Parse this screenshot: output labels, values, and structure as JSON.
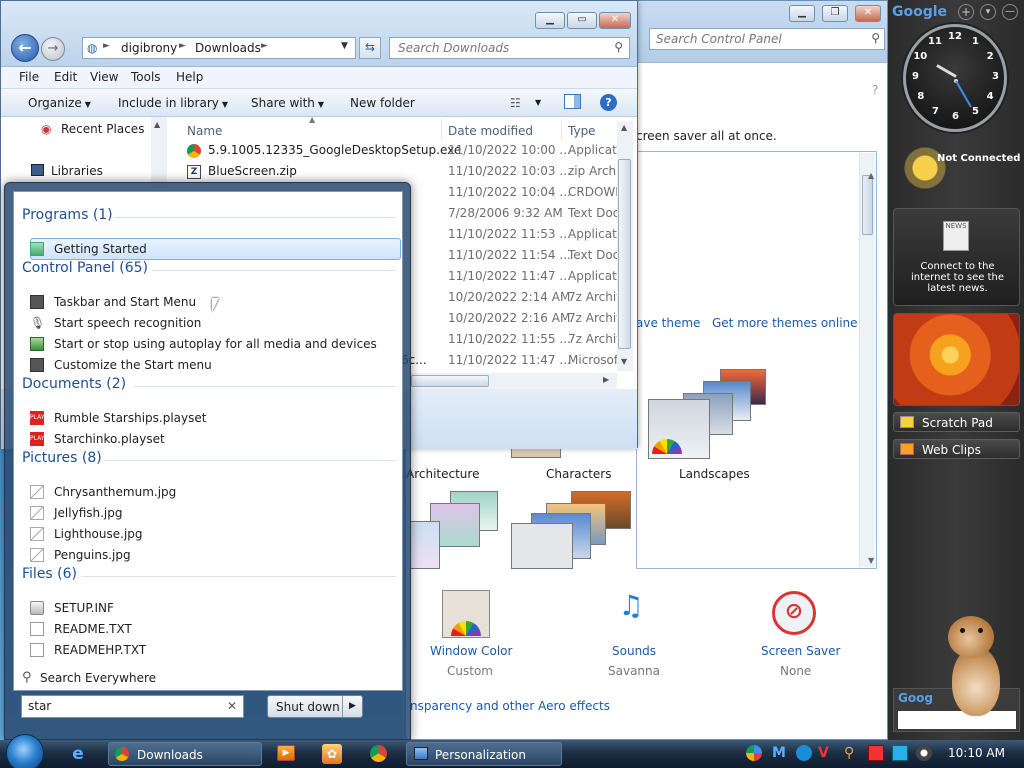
{
  "control_panel": {
    "search_placeholder": "Search Control Panel",
    "description": "creen saver all at once.",
    "save_theme": "ave theme",
    "get_more_themes": "Get more themes online",
    "themes": [
      {
        "label": "Architecture"
      },
      {
        "label": "Characters"
      },
      {
        "label": "Landscapes"
      }
    ],
    "bottom_items": [
      {
        "label": "Window Color",
        "value": "Custom"
      },
      {
        "label": "Sounds",
        "value": "Savanna"
      },
      {
        "label": "Screen Saver",
        "value": "None"
      }
    ],
    "aero_link": "nsparency and other Aero effects"
  },
  "explorer": {
    "breadcrumb": [
      "digibrony",
      "Downloads"
    ],
    "search_placeholder": "Search Downloads",
    "menu": [
      "File",
      "Edit",
      "View",
      "Tools",
      "Help"
    ],
    "toolbar": {
      "organize": "Organize",
      "include": "Include in library",
      "share": "Share with",
      "new_folder": "New folder"
    },
    "nav": {
      "recent": "Recent Places",
      "libraries": "Libraries"
    },
    "columns": {
      "name": "Name",
      "date": "Date modified",
      "type": "Type"
    },
    "files": [
      {
        "name": "5.9.1005.12335_GoogleDesktopSetup.exe",
        "date": "11/10/2022 10:00 ...",
        "type": "Applicati"
      },
      {
        "name": "BlueScreen.zip",
        "date": "11/10/2022 10:03 ...",
        "type": "zip Archi"
      },
      {
        "name": "",
        "date": "11/10/2022 10:04 ...",
        "type": "CRDOWN"
      },
      {
        "name": "",
        "date": "7/28/2006 9:32 AM",
        "type": "Text Doc"
      },
      {
        "name": "",
        "date": "11/10/2022 11:53 ...",
        "type": "Applicati"
      },
      {
        "name": "",
        "date": "11/10/2022 11:54 ...",
        "type": "Text Doc"
      },
      {
        "name": "",
        "date": "11/10/2022 11:47 ...",
        "type": "Applicati"
      },
      {
        "name": "",
        "date": "10/20/2022 2:14 AM",
        "type": "7z Archiv"
      },
      {
        "name": "",
        "date": "10/20/2022 2:16 AM",
        "type": "7z Archiv"
      },
      {
        "name": "",
        "date": "11/10/2022 11:55 ...",
        "type": "7z Archiv"
      },
      {
        "name": "6c...",
        "date": "11/10/2022 11:47 ...",
        "type": "Microsof"
      }
    ]
  },
  "start_menu": {
    "programs": {
      "heading": "Programs (1)",
      "items": [
        "Getting Started"
      ]
    },
    "control_panel": {
      "heading": "Control Panel (65)",
      "items": [
        "Taskbar and Start Menu",
        "Start speech recognition",
        "Start or stop using autoplay for all media and devices",
        "Customize the Start menu"
      ]
    },
    "documents": {
      "heading": "Documents (2)",
      "items": [
        "Rumble Starships.playset",
        "Starchinko.playset"
      ]
    },
    "pictures": {
      "heading": "Pictures (8)",
      "items": [
        "Chrysanthemum.jpg",
        "Jellyfish.jpg",
        "Lighthouse.jpg",
        "Penguins.jpg"
      ]
    },
    "files": {
      "heading": "Files (6)",
      "items": [
        "SETUP.INF",
        "README.TXT",
        "READMEHP.TXT"
      ]
    },
    "search_everywhere": "Search Everywhere",
    "search_value": "star",
    "shutdown": "Shut down"
  },
  "sidebar": {
    "brand": "Google",
    "weather_status": "Not Connected",
    "news_message": "Connect to the internet to see the latest news.",
    "scratch_pad": "Scratch Pad",
    "web_clips": "Web Clips",
    "clock_numbers": [
      "12",
      "1",
      "2",
      "3",
      "4",
      "5",
      "6",
      "7",
      "8",
      "9",
      "10",
      "11"
    ],
    "search_brand": "Goog"
  },
  "taskbar": {
    "downloads": "Downloads",
    "personalization": "Personalization",
    "time": "10:10 AM"
  },
  "icons": {
    "start": "windows-orb-icon",
    "ie": "internet-explorer-icon",
    "media": "media-player-icon",
    "chrome": "chrome-icon"
  }
}
